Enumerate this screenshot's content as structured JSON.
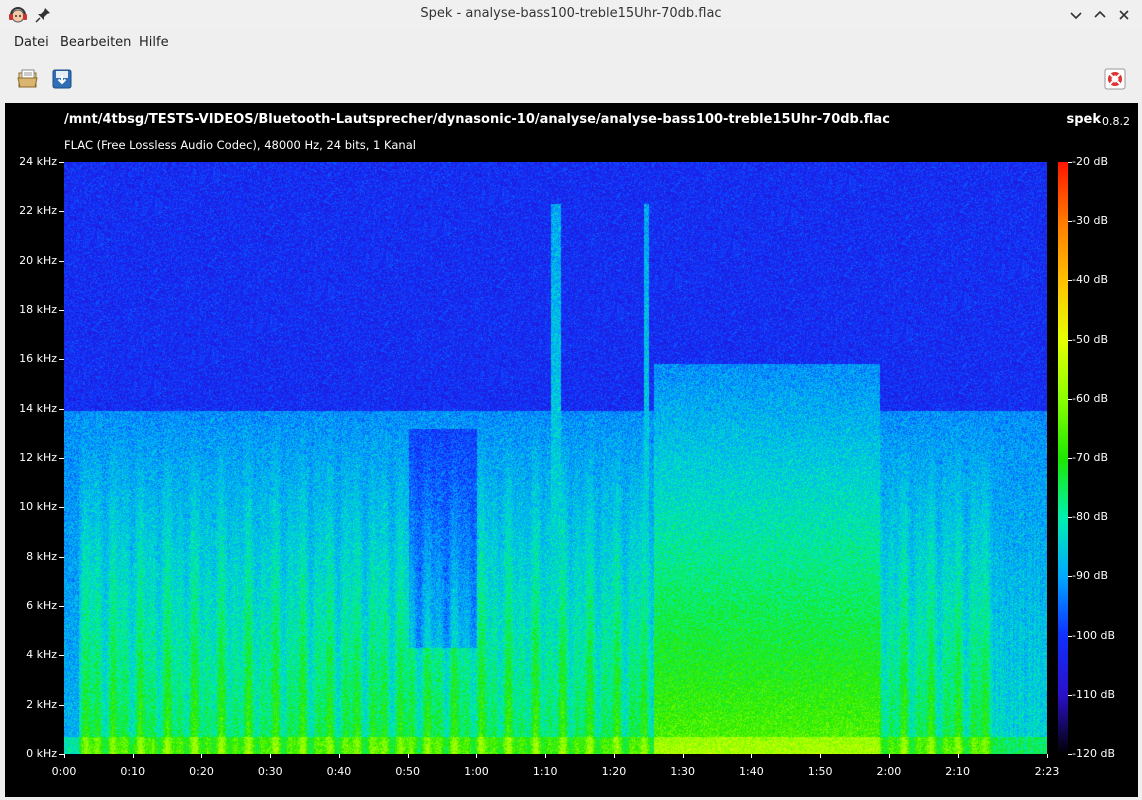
{
  "window": {
    "title": "Spek - analyse-bass100-treble15Uhr-70db.flac"
  },
  "menu": {
    "items": [
      "Datei",
      "Bearbeiten",
      "Hilfe"
    ]
  },
  "header": {
    "file_path": "/mnt/4tbsg/TESTS-VIDEOS/Bluetooth-Lautsprecher/dynasonic-10/analyse/analyse-bass100-treble15Uhr-70db.flac",
    "file_info": "FLAC (Free Lossless Audio Codec), 48000 Hz, 24 bits, 1 Kanal",
    "app_name": "spek",
    "app_version": "0.8.2"
  },
  "axes": {
    "freq_labels": [
      "24 kHz",
      "22 kHz",
      "20 kHz",
      "18 kHz",
      "16 kHz",
      "14 kHz",
      "12 kHz",
      "10 kHz",
      "8 kHz",
      "6 kHz",
      "4 kHz",
      "2 kHz",
      "0 kHz"
    ],
    "time_labels": [
      "0:00",
      "0:10",
      "0:20",
      "0:30",
      "0:40",
      "0:50",
      "1:00",
      "1:10",
      "1:20",
      "1:30",
      "1:40",
      "1:50",
      "2:00",
      "2:10",
      "2:23"
    ],
    "db_labels": [
      "-20 dB",
      "-30 dB",
      "-40 dB",
      "-50 dB",
      "-60 dB",
      "-70 dB",
      "-80 dB",
      "-90 dB",
      "-100 dB",
      "-110 dB",
      "-120 dB"
    ]
  },
  "icons": {
    "app": "headphones-face-icon",
    "pin": "pin-icon",
    "open": "open-file-icon",
    "save": "save-icon",
    "preferences": "lifebuoy-icon"
  }
}
